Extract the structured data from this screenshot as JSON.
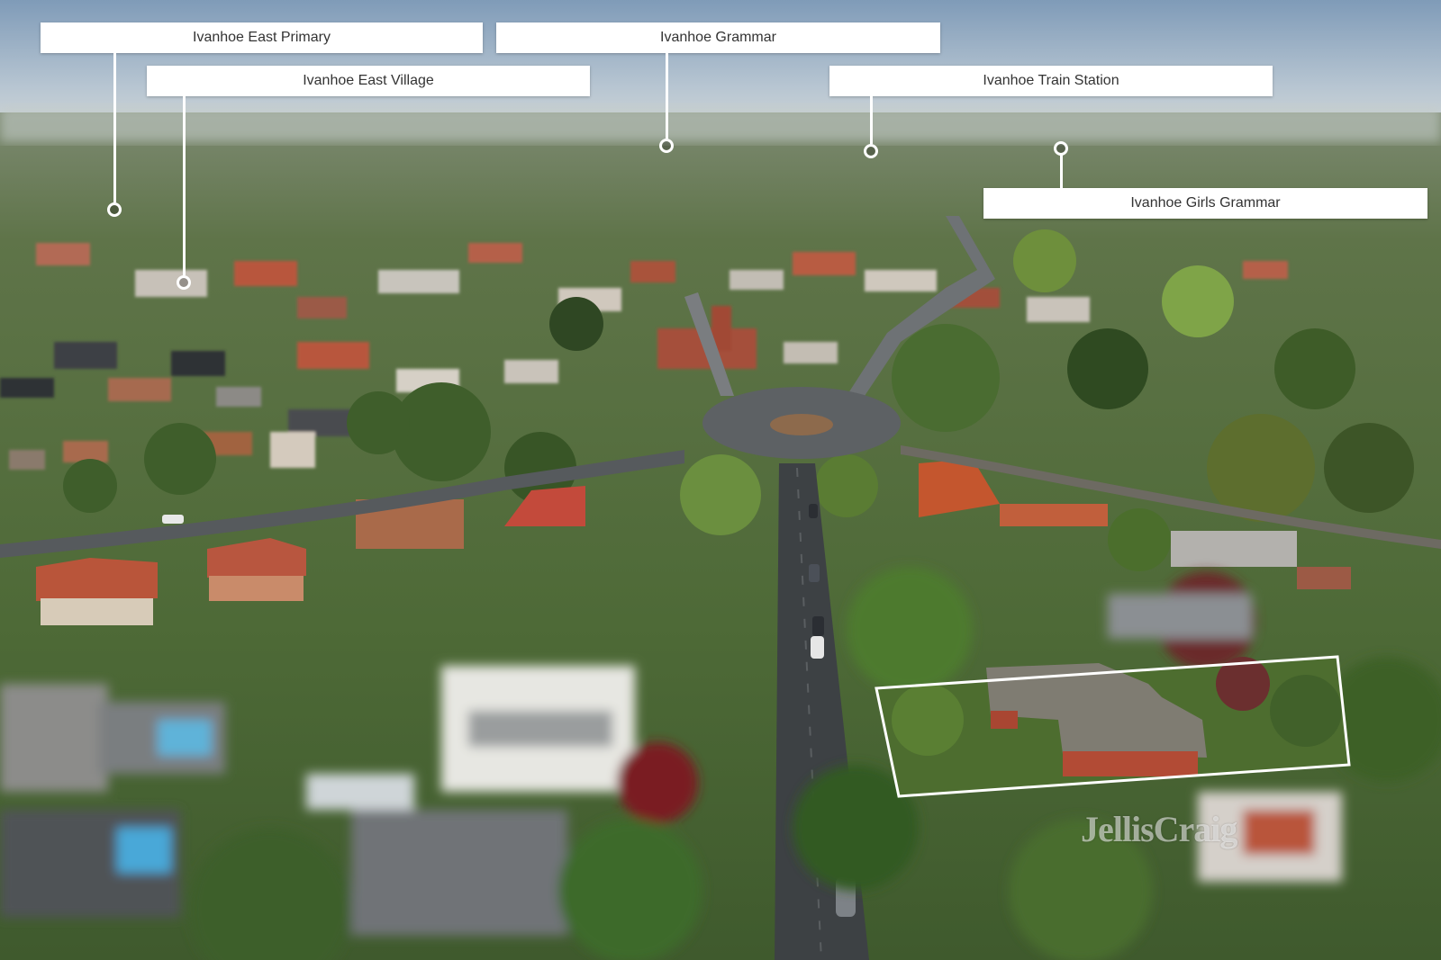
{
  "labels": {
    "ivanhoe_east_primary": "Ivanhoe East Primary",
    "ivanhoe_east_village": "Ivanhoe East Village",
    "ivanhoe_grammar": "Ivanhoe Grammar",
    "ivanhoe_train_station": "Ivanhoe Train Station",
    "ivanhoe_girls_grammar": "Ivanhoe Girls Grammar"
  },
  "watermark": "JellisCraig",
  "colors": {
    "sky_top": "#8ea6bf",
    "haze": "#c9d3d9",
    "canopy": "#4d6b3a",
    "roof_terracotta": "#b4553d",
    "road": "#3f4346",
    "label_bg": "#ffffff",
    "label_text": "#333333"
  }
}
